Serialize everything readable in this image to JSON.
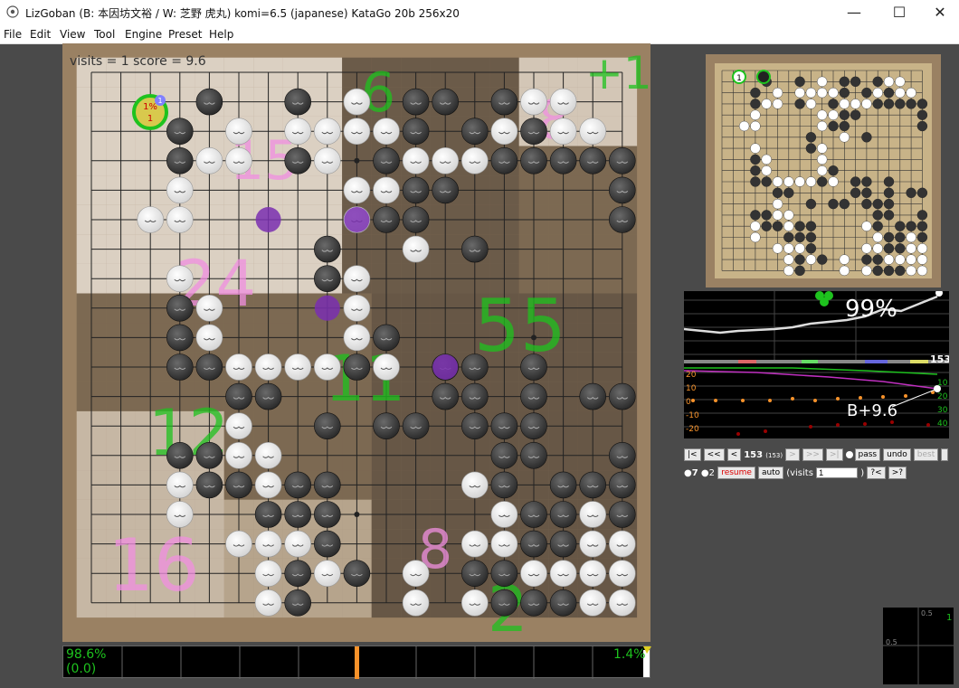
{
  "window": {
    "title": "LizGoban (B: 本因坊文裕 / W: 芝野 虎丸)  komi=6.5 (japanese) KataGo 20b 256x20",
    "minimize_icon": "minimize-icon",
    "maximize_icon": "maximize-icon",
    "close_icon": "close-icon"
  },
  "menu": [
    "File",
    "Edit",
    "View",
    "Tool",
    "Engine",
    "Preset",
    "Help"
  ],
  "board": {
    "header_text": "visits = 1  score = 9.6",
    "stone_label_winrate": "1%",
    "stone_label_order": "1",
    "stone_label_badge": "1",
    "area_numbers": [
      "6",
      "+1",
      "8",
      "15",
      "24",
      "55",
      "11",
      "12",
      "16",
      "8",
      "2"
    ]
  },
  "sub_board": {
    "marker": "1"
  },
  "graph": {
    "winrate_label": "99%",
    "move_number": "153",
    "score_label": "B+9.6",
    "left_scale": [
      "20",
      "10",
      "0",
      "-10",
      "-20"
    ],
    "right_scale": [
      "10",
      "20",
      "30",
      "40"
    ]
  },
  "controls": {
    "first": "|<",
    "prev10": "<<",
    "prev": "<",
    "move_num": "153",
    "move_total": "(153)",
    "next": ">",
    "next10": ">>",
    "last": ">|",
    "pass": "pass",
    "undo": "undo",
    "best": "best",
    "extra": "",
    "black_captures": "7",
    "white_captures": "2",
    "resume": "resume",
    "auto": "auto",
    "visits_label": "(visits",
    "visits_value": "1",
    "visits_close": ")",
    "q1": "?<",
    "q2": ">?"
  },
  "winrate_bar": {
    "left_pct": "98.6%",
    "left_sub": "(0.0)",
    "right_pct": "1.4%"
  },
  "mini_graph": {
    "label1": "0.5",
    "label2": "0.5",
    "label3": "1"
  },
  "colors": {
    "accent_green": "#1ec21e",
    "area_pink": "#f08fe0",
    "orange": "#f7922a"
  }
}
